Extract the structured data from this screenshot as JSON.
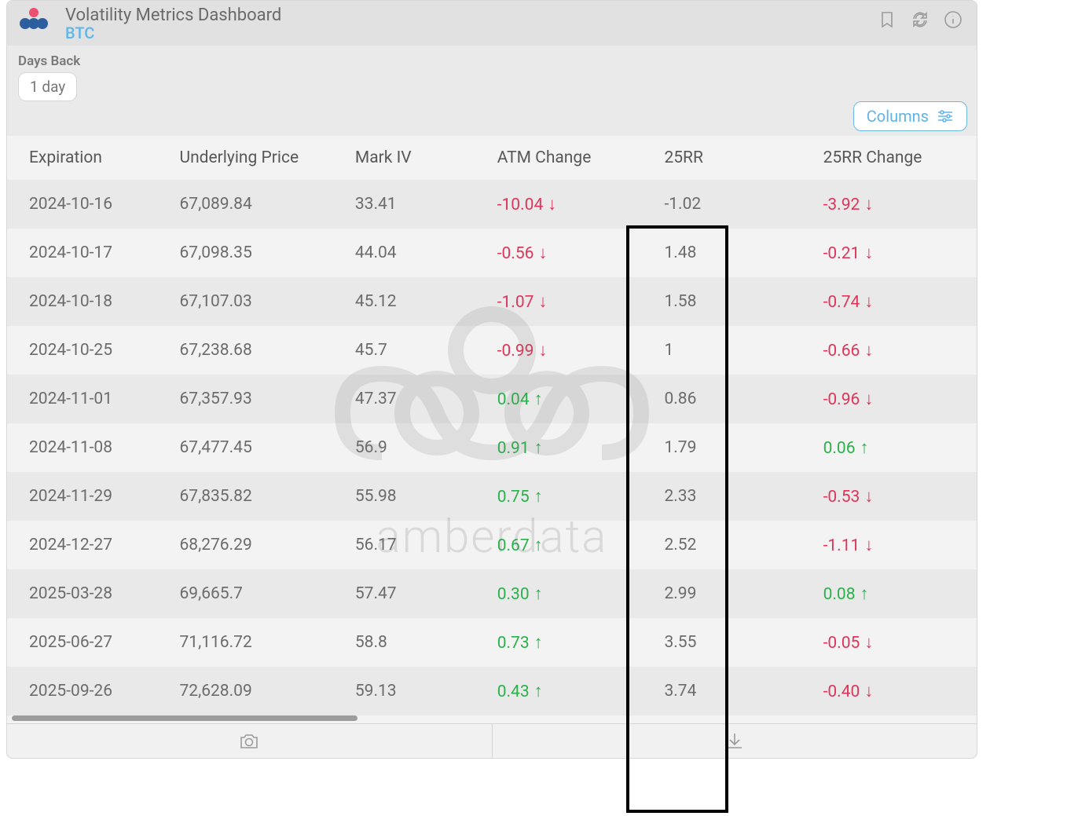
{
  "header": {
    "title": "Volatility Metrics Dashboard",
    "subtitle": "BTC"
  },
  "controls": {
    "days_back_label": "Days Back",
    "days_back_value": "1 day",
    "columns_button": "Columns"
  },
  "table": {
    "headers": {
      "expiration": "Expiration",
      "underlying": "Underlying Price",
      "markiv": "Mark IV",
      "atm": "ATM Change",
      "rr": "25RR",
      "rrc": "25RR Change"
    },
    "rows": [
      {
        "exp": "2024-10-16",
        "up": "67,089.84",
        "mk": "33.41",
        "atm": "-10.04",
        "atm_dir": "down",
        "rr": "-1.02",
        "rrc": "-3.92",
        "rrc_dir": "down"
      },
      {
        "exp": "2024-10-17",
        "up": "67,098.35",
        "mk": "44.04",
        "atm": "-0.56",
        "atm_dir": "down",
        "rr": "1.48",
        "rrc": "-0.21",
        "rrc_dir": "down"
      },
      {
        "exp": "2024-10-18",
        "up": "67,107.03",
        "mk": "45.12",
        "atm": "-1.07",
        "atm_dir": "down",
        "rr": "1.58",
        "rrc": "-0.74",
        "rrc_dir": "down"
      },
      {
        "exp": "2024-10-25",
        "up": "67,238.68",
        "mk": "45.7",
        "atm": "-0.99",
        "atm_dir": "down",
        "rr": "1",
        "rrc": "-0.66",
        "rrc_dir": "down"
      },
      {
        "exp": "2024-11-01",
        "up": "67,357.93",
        "mk": "47.37",
        "atm": "0.04",
        "atm_dir": "up",
        "rr": "0.86",
        "rrc": "-0.96",
        "rrc_dir": "down"
      },
      {
        "exp": "2024-11-08",
        "up": "67,477.45",
        "mk": "56.9",
        "atm": "0.91",
        "atm_dir": "up",
        "rr": "1.79",
        "rrc": "0.06",
        "rrc_dir": "up"
      },
      {
        "exp": "2024-11-29",
        "up": "67,835.82",
        "mk": "55.98",
        "atm": "0.75",
        "atm_dir": "up",
        "rr": "2.33",
        "rrc": "-0.53",
        "rrc_dir": "down"
      },
      {
        "exp": "2024-12-27",
        "up": "68,276.29",
        "mk": "56.17",
        "atm": "0.67",
        "atm_dir": "up",
        "rr": "2.52",
        "rrc": "-1.11",
        "rrc_dir": "down"
      },
      {
        "exp": "2025-03-28",
        "up": "69,665.7",
        "mk": "57.47",
        "atm": "0.30",
        "atm_dir": "up",
        "rr": "2.99",
        "rrc": "0.08",
        "rrc_dir": "up"
      },
      {
        "exp": "2025-06-27",
        "up": "71,116.72",
        "mk": "58.8",
        "atm": "0.73",
        "atm_dir": "up",
        "rr": "3.55",
        "rrc": "-0.05",
        "rrc_dir": "down"
      },
      {
        "exp": "2025-09-26",
        "up": "72,628.09",
        "mk": "59.13",
        "atm": "0.43",
        "atm_dir": "up",
        "rr": "3.74",
        "rrc": "-0.40",
        "rrc_dir": "down"
      }
    ]
  },
  "watermark": "amberdata"
}
